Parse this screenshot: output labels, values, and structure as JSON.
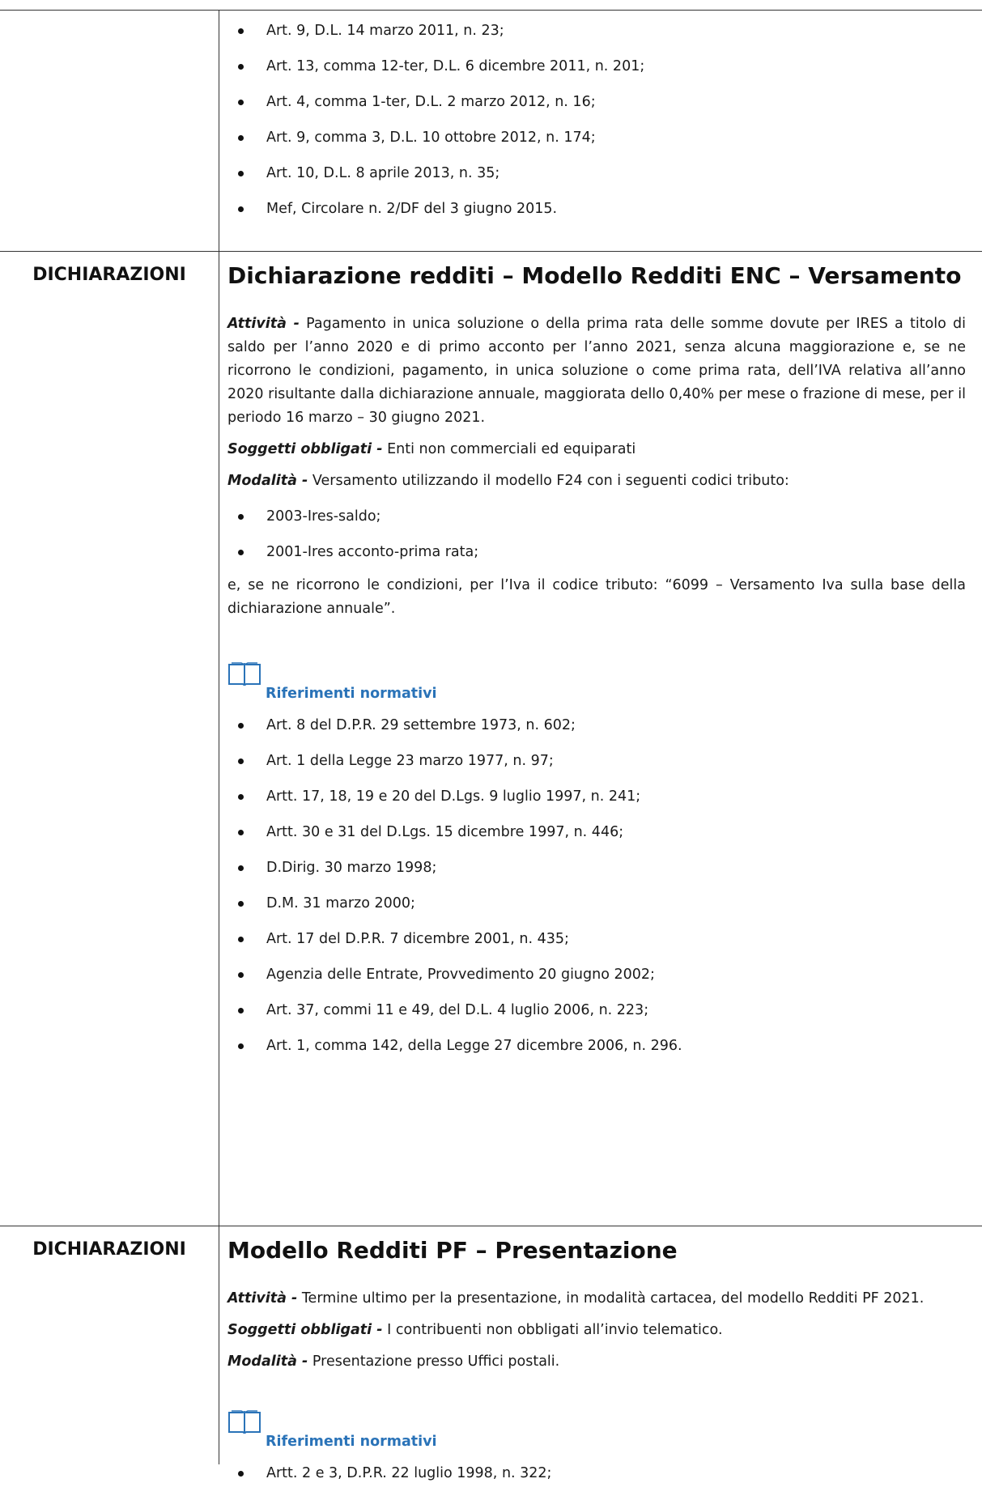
{
  "top_refs": [
    "Art. 9, D.L. 14 marzo 2011, n. 23;",
    "Art. 13, comma 12-ter, D.L. 6 dicembre 2011, n. 201;",
    "Art. 4, comma 1-ter, D.L. 2 marzo 2012, n. 16;",
    "Art. 9, comma 3, D.L. 10 ottobre 2012, n. 174;",
    "Art. 10, D.L. 8 aprile 2013, n. 35;",
    "Mef, Circolare n. 2/DF del 3 giugno 2015."
  ],
  "sections": [
    {
      "category": "DICHIARAZIONI",
      "title": "Dichiarazione redditi – Modello Redditi ENC – Versamento",
      "activity_label": "Attività -",
      "activity_text": "Pagamento in unica soluzione o della prima rata delle somme dovute per IRES a titolo di saldo per l’anno 2020 e di primo acconto per l’anno 2021, senza alcuna maggiorazione e, se ne ricorrono le condizioni, pagamento, in unica soluzione o come prima rata, dell’IVA relativa all’anno 2020 risultante dalla dichiarazione annuale, maggiorata dello 0,40% per mese o frazione di mese, per il periodo 16 marzo – 30 giugno 2021.",
      "subjects_label": "Soggetti obbligati -",
      "subjects_text": "Enti non commerciali ed equiparati",
      "mode_label": "Modalità -",
      "mode_text": "Versamento utilizzando il modello F24 con i seguenti codici tributo:",
      "codes": [
        "2003-Ires-saldo;",
        "2001-Ires acconto-prima rata;"
      ],
      "note": "e, se ne ricorrono le condizioni, per l’Iva il codice tributo: “6099 – Versamento Iva sulla base della dichiarazione annuale”.",
      "refs_label": "Riferimenti normativi",
      "refs": [
        "Art. 8 del D.P.R. 29 settembre 1973, n. 602;",
        "Art. 1 della Legge 23 marzo 1977, n. 97;",
        "Artt. 17, 18, 19 e 20 del D.Lgs. 9 luglio 1997, n. 241;",
        "Artt. 30 e 31 del D.Lgs. 15 dicembre 1997, n. 446;",
        "D.Dirig. 30 marzo 1998;",
        "D.M. 31 marzo 2000;",
        "Art. 17 del D.P.R. 7 dicembre 2001, n. 435;",
        "Agenzia delle Entrate, Provvedimento 20 giugno 2002;",
        "Art. 37, commi 11 e 49, del D.L. 4 luglio 2006, n. 223;",
        "Art. 1, comma 142, della Legge 27 dicembre 2006, n. 296."
      ]
    },
    {
      "category": "DICHIARAZIONI",
      "title": "Modello Redditi PF – Presentazione",
      "activity_label": "Attività -",
      "activity_text": "Termine ultimo per la presentazione, in modalità cartacea, del modello Redditi PF 2021.",
      "subjects_label": "Soggetti obbligati -",
      "subjects_text": "I contribuenti non obbligati all’invio telematico.",
      "mode_label": "Modalità -",
      "mode_text": "Presentazione presso Uffici postali.",
      "refs_label": "Riferimenti normativi",
      "refs": [
        "Artt. 2 e 3, D.P.R. 22 luglio 1998, n. 322;"
      ]
    }
  ]
}
